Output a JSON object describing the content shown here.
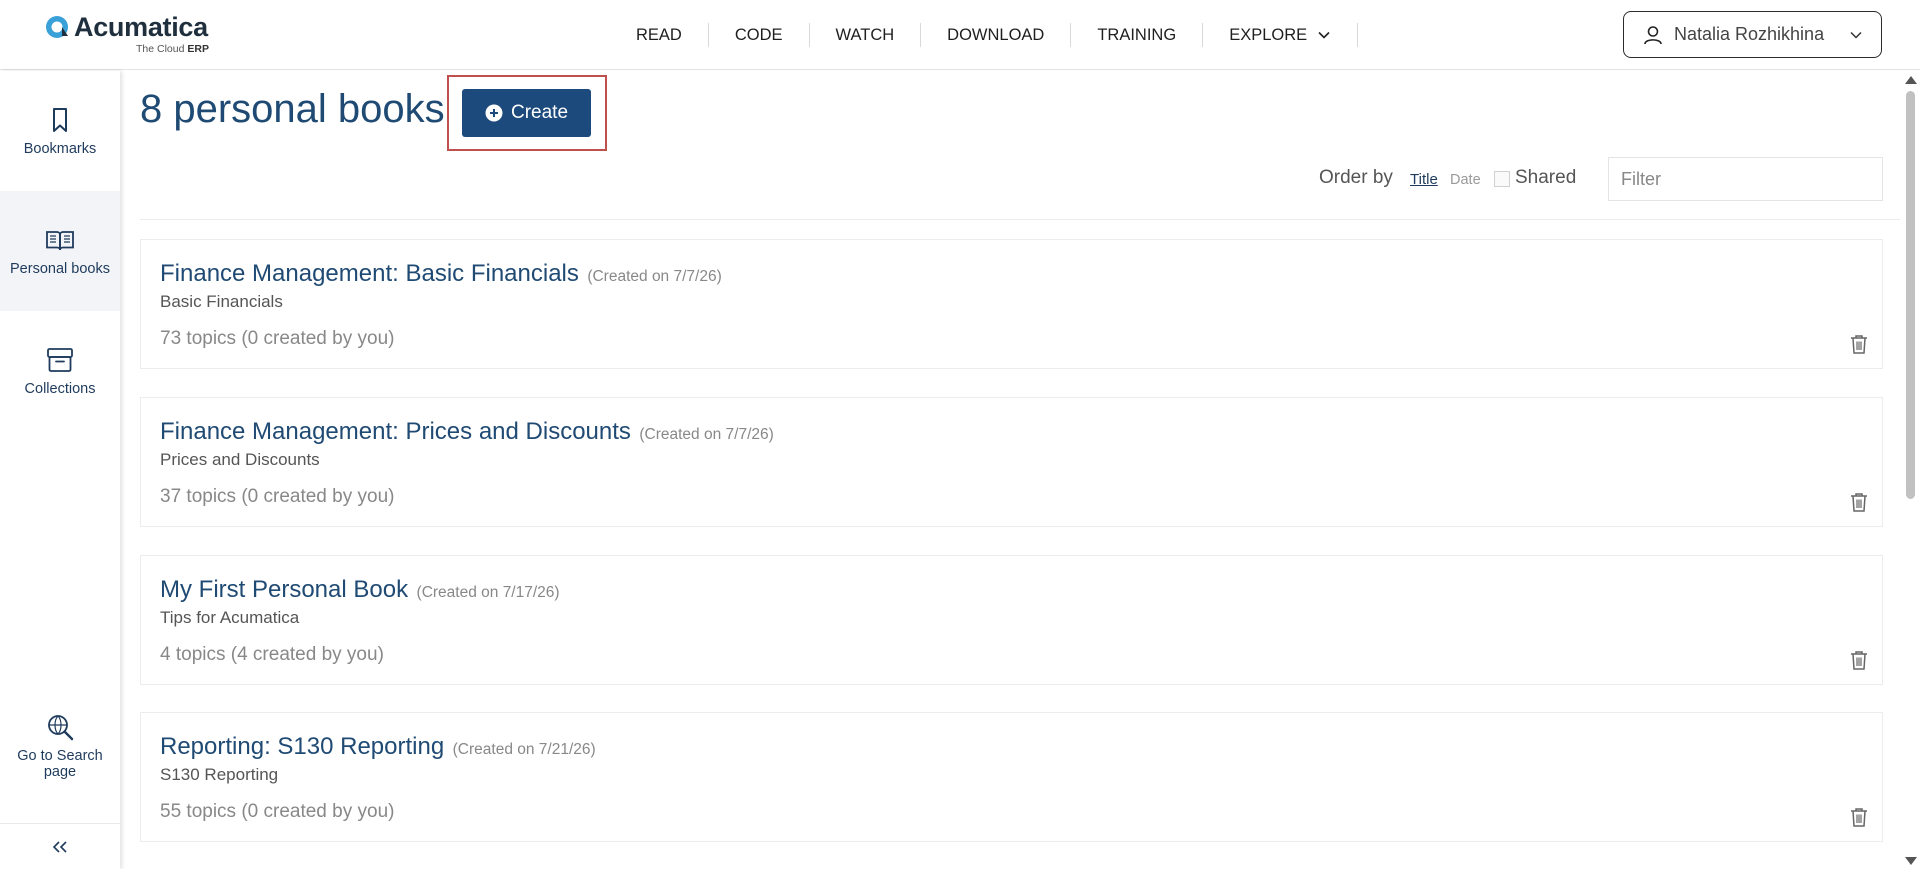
{
  "brand": {
    "name": "Acumatica",
    "tagline_prefix": "The Cloud",
    "tagline_bold": "ERP",
    "accent_color": "#1c4a7c",
    "logo_color": "#3aa0d8"
  },
  "topnav": {
    "items": [
      {
        "label": "READ"
      },
      {
        "label": "CODE"
      },
      {
        "label": "WATCH"
      },
      {
        "label": "DOWNLOAD"
      },
      {
        "label": "TRAINING"
      },
      {
        "label": "EXPLORE",
        "icon": "chevron-down-icon"
      }
    ]
  },
  "user": {
    "name": "Natalia Rozhikhina",
    "icon": "user-icon"
  },
  "sidebar": {
    "items": [
      {
        "label": "Bookmarks",
        "icon": "bookmark-icon"
      },
      {
        "label": "Personal books",
        "icon": "open-book-icon",
        "active": true
      },
      {
        "label": "Collections",
        "icon": "archive-box-icon"
      },
      {
        "label_line1": "Go to Search",
        "label_line2": "page",
        "icon": "search-globe-icon"
      }
    ],
    "collapse_icon": "double-chevron-left-icon"
  },
  "main": {
    "title": "8 personal books",
    "create_label": "Create",
    "create_icon": "plus-circle-icon",
    "order_by_label": "Order by",
    "order_title": "Title",
    "order_date": "Date",
    "shared_label": "Shared",
    "filter_placeholder": "Filter",
    "books": [
      {
        "title": "Finance Management: Basic Financials",
        "created": "(Created on 7/7/26)",
        "subtitle": "Basic Financials",
        "topics": "73 topics (0 created by you)"
      },
      {
        "title": "Finance Management: Prices and Discounts",
        "created": "(Created on 7/7/26)",
        "subtitle": "Prices and Discounts",
        "topics": "37 topics (0 created by you)"
      },
      {
        "title": "My First Personal Book",
        "created": "(Created on 7/17/26)",
        "subtitle": "Tips for Acumatica",
        "topics": "4 topics (4 created by you)"
      },
      {
        "title": "Reporting: S130 Reporting",
        "created": "(Created on 7/21/26)",
        "subtitle": "S130 Reporting",
        "topics": "55 topics (0 created by you)"
      }
    ]
  }
}
